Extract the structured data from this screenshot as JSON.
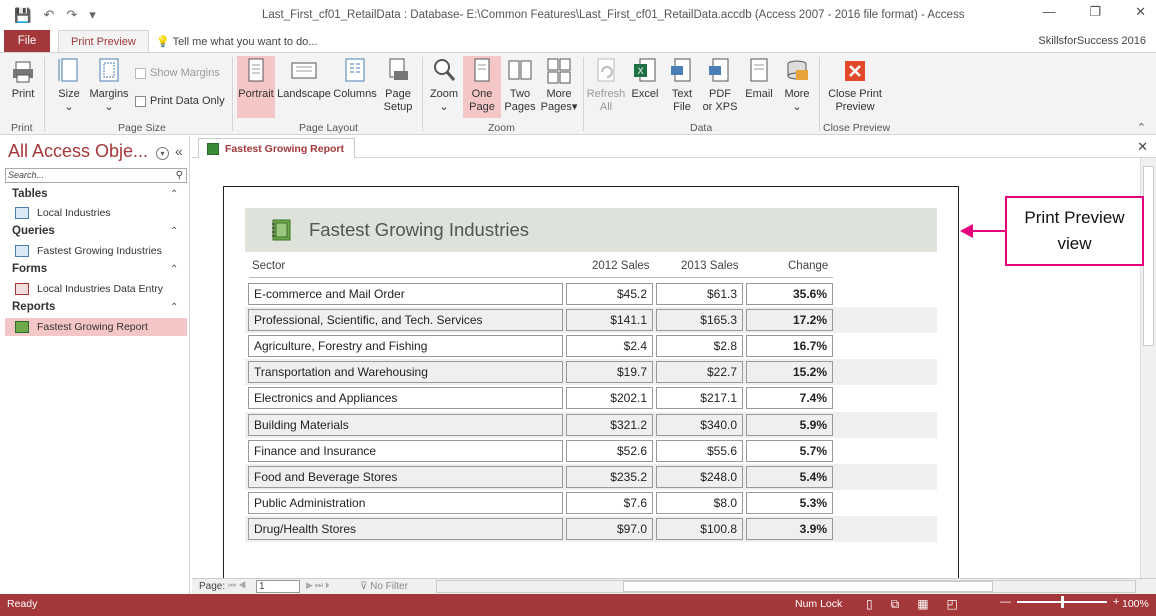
{
  "window": {
    "title": "Last_First_cf01_RetailData : Database- E:\\Common Features\\Last_First_cf01_RetailData.accdb (Access 2007 - 2016 file format) - Access",
    "controls": {
      "minimize": "—",
      "restore": "❐",
      "close": "✕"
    }
  },
  "qat": {
    "save_icon": "💾",
    "undo_icon": "↶",
    "redo_icon": "↷",
    "customize_icon": "▾"
  },
  "tabs": {
    "file": "File",
    "print_preview": "Print Preview",
    "tell_me": "Tell me what you want to do...",
    "account": "SkillsforSuccess 2016"
  },
  "ribbon": {
    "print": "Print",
    "size": "Size",
    "margins": "Margins",
    "show_margins": "Show Margins",
    "print_data_only": "Print Data Only",
    "portrait": "Portrait",
    "landscape": "Landscape",
    "columns": "Columns",
    "page_setup_1": "Page",
    "page_setup_2": "Setup",
    "zoom": "Zoom",
    "one_page_1": "One",
    "one_page_2": "Page",
    "two_pages_1": "Two",
    "two_pages_2": "Pages",
    "more_pages_1": "More",
    "more_pages_2": "Pages",
    "refresh_all_1": "Refresh",
    "refresh_all_2": "All",
    "excel": "Excel",
    "text_file_1": "Text",
    "text_file_2": "File",
    "pdf_1": "PDF",
    "pdf_2": "or XPS",
    "email": "Email",
    "more": "More",
    "close_preview_1": "Close Print",
    "close_preview_2": "Preview",
    "groups": {
      "print": "Print",
      "page_size": "Page Size",
      "page_layout": "Page Layout",
      "zoom": "Zoom",
      "data": "Data",
      "close_preview": "Close Preview"
    }
  },
  "nav": {
    "header": "All Access Obje...",
    "search_placeholder": "Search...",
    "sections": [
      {
        "label": "Tables",
        "items": [
          "Local Industries"
        ]
      },
      {
        "label": "Queries",
        "items": [
          "Fastest Growing Industries"
        ]
      },
      {
        "label": "Forms",
        "items": [
          "Local Industries Data Entry"
        ]
      },
      {
        "label": "Reports",
        "items": [
          "Fastest Growing Report"
        ]
      }
    ]
  },
  "doc_tab": {
    "label": "Fastest Growing Report"
  },
  "report": {
    "title": "Fastest Growing Industries",
    "headers": [
      "Sector",
      "2012 Sales",
      "2013 Sales",
      "Change"
    ],
    "rows": [
      [
        "E-commerce and Mail Order",
        "$45.2",
        "$61.3",
        "35.6%"
      ],
      [
        "Professional, Scientific, and Tech. Services",
        "$141.1",
        "$165.3",
        "17.2%"
      ],
      [
        "Agriculture, Forestry and Fishing",
        "$2.4",
        "$2.8",
        "16.7%"
      ],
      [
        "Transportation and Warehousing",
        "$19.7",
        "$22.7",
        "15.2%"
      ],
      [
        "Electronics and Appliances",
        "$202.1",
        "$217.1",
        "7.4%"
      ],
      [
        "Building Materials",
        "$321.2",
        "$340.0",
        "5.9%"
      ],
      [
        "Finance and Insurance",
        "$52.6",
        "$55.6",
        "5.7%"
      ],
      [
        "Food and Beverage Stores",
        "$235.2",
        "$248.0",
        "5.4%"
      ],
      [
        "Public Administration",
        "$7.6",
        "$8.0",
        "5.3%"
      ],
      [
        "Drug/Health Stores",
        "$97.0",
        "$100.8",
        "3.9%"
      ]
    ]
  },
  "callout": {
    "line1": "Print Preview",
    "line2": "view"
  },
  "record_nav": {
    "page_label": "Page:",
    "page_value": "1",
    "filter": "No Filter"
  },
  "status": {
    "ready": "Ready",
    "num_lock": "Num Lock",
    "zoom_pct": "100%"
  },
  "colors": {
    "accent": "#a4373a",
    "selected": "#f4c6c6",
    "callout": "#e6007e"
  }
}
